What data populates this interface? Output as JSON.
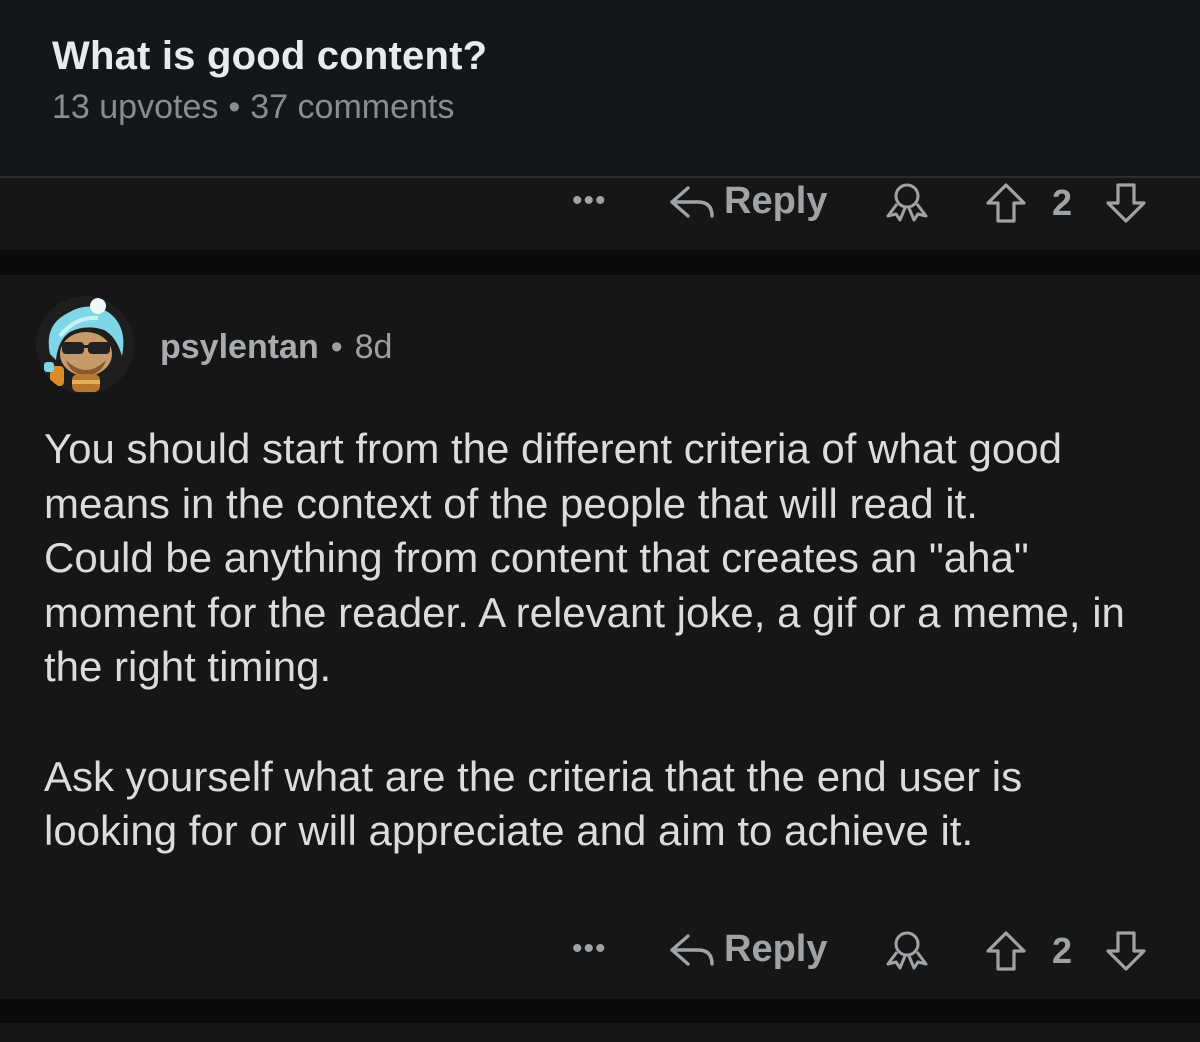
{
  "post": {
    "title": "What is good content?",
    "upvotes": "13 upvotes",
    "separator": "•",
    "comments": "37 comments"
  },
  "prev_comment_actions": {
    "more": "•••",
    "reply": "Reply",
    "score": "2"
  },
  "comment": {
    "author": "psylentan",
    "separator": "•",
    "age": "8d",
    "paragraph1": "You should start from the different criteria of what good means in the context of the people that will read it.",
    "paragraph2": "Could be anything from content that creates an \"aha\" moment for the reader. A relevant joke, a gif or a meme, in the right timing.",
    "paragraph3": "Ask yourself what are the criteria that the end user is looking for or will appreciate and aim to achieve it.",
    "actions": {
      "more": "•••",
      "reply": "Reply",
      "score": "2"
    }
  },
  "icons": {
    "reply": "reply-arrow-icon",
    "award": "award-icon",
    "upvote": "upvote-arrow-icon",
    "downvote": "downvote-arrow-icon",
    "more": "more-dots-icon"
  },
  "colors": {
    "background": "#0b0b0b",
    "header_bg": "#13171a",
    "card_bg": "#161616",
    "text": "#dadcde",
    "muted": "#a0a3a6"
  }
}
